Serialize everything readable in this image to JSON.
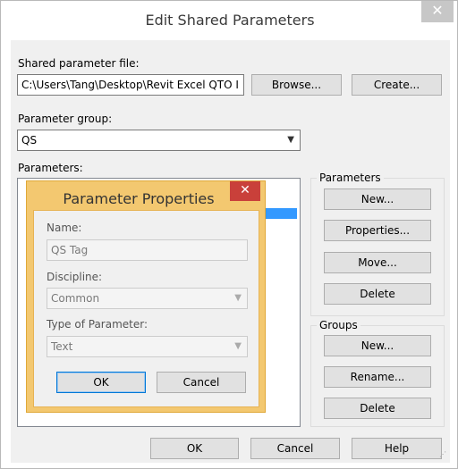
{
  "window": {
    "title": "Edit Shared Parameters",
    "close_glyph": "✕"
  },
  "shared_file": {
    "label": "Shared parameter file:",
    "path": "C:\\Users\\Tang\\Desktop\\Revit Excel QTO I",
    "browse_label": "Browse...",
    "create_label": "Create..."
  },
  "parameter_group": {
    "label": "Parameter group:",
    "value": "QS"
  },
  "parameters": {
    "label": "Parameters:"
  },
  "params_box": {
    "title": "Parameters",
    "new_label": "New...",
    "properties_label": "Properties...",
    "move_label": "Move...",
    "delete_label": "Delete"
  },
  "groups_box": {
    "title": "Groups",
    "new_label": "New...",
    "rename_label": "Rename...",
    "delete_label": "Delete"
  },
  "footer": {
    "ok_label": "OK",
    "cancel_label": "Cancel",
    "help_label": "Help"
  },
  "param_dialog": {
    "title": "Parameter Properties",
    "close_glyph": "✕",
    "name_label": "Name:",
    "name_value": "QS Tag",
    "discipline_label": "Discipline:",
    "discipline_value": "Common",
    "type_label": "Type of Parameter:",
    "type_value": "Text",
    "ok_label": "OK",
    "cancel_label": "Cancel"
  },
  "icons": {
    "dropdown": "chevron-down-icon",
    "close": "close-icon",
    "resize": "resize-grip-icon"
  }
}
